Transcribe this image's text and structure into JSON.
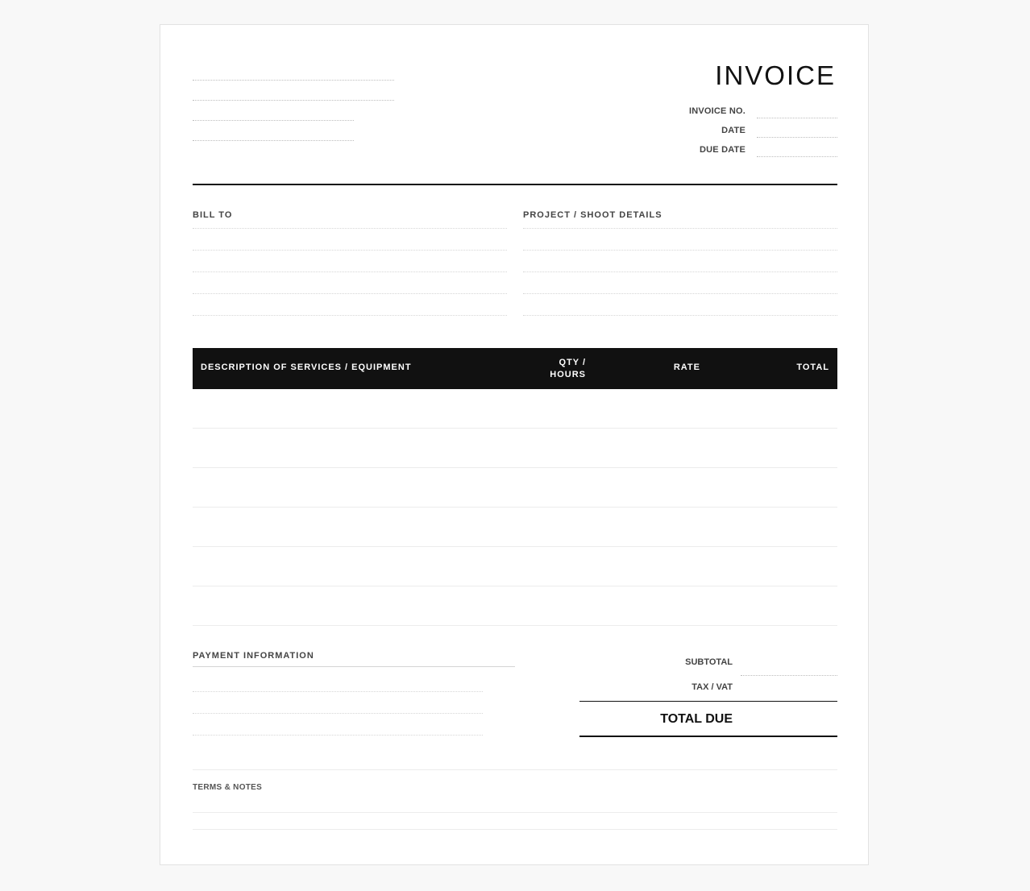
{
  "header": {
    "title": "INVOICE",
    "meta_labels": [
      "INVOICE NO.",
      "DATE",
      "DUE DATE"
    ]
  },
  "bill_to": {
    "label": "BILL TO"
  },
  "project": {
    "label": "PROJECT / SHOOT DETAILS"
  },
  "table": {
    "columns": {
      "description": "DESCRIPTION OF SERVICES / EQUIPMENT",
      "qty_line1": "QTY /",
      "qty_line2": "HOURS",
      "rate": "RATE",
      "total": "TOTAL"
    },
    "row_count": 6
  },
  "payment": {
    "label": "PAYMENT INFORMATION"
  },
  "summary": {
    "subtotal": "SUBTOTAL",
    "tax": "TAX / VAT",
    "total_due": "TOTAL DUE"
  },
  "terms": {
    "label": "TERMS & NOTES"
  }
}
